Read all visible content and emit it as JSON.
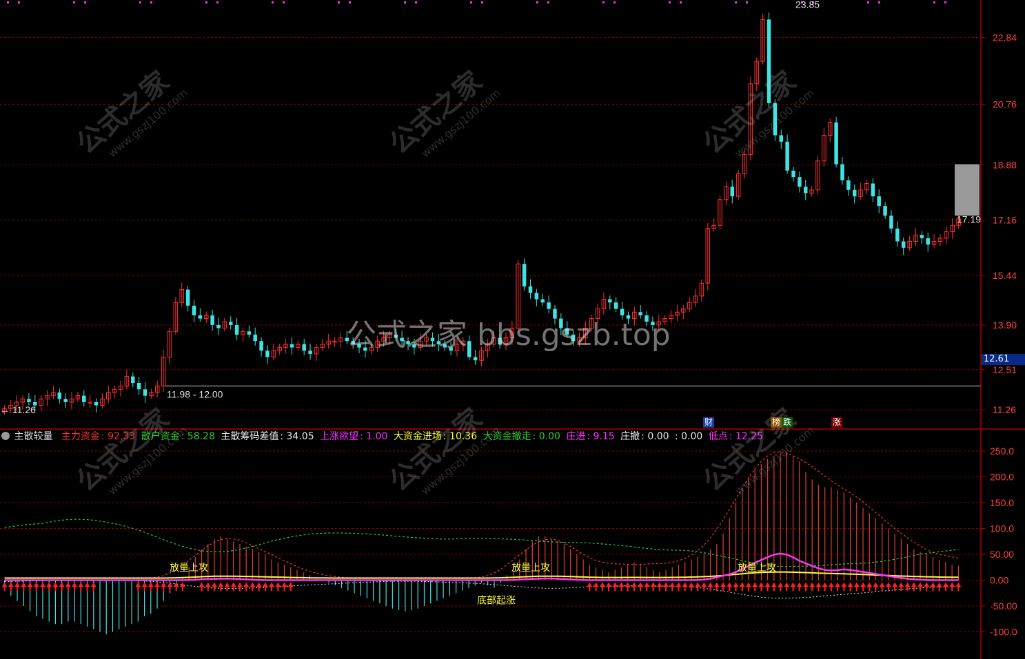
{
  "chart_data": [
    {
      "type": "candlestick",
      "title": "",
      "y_axis_labels": [
        "22.84",
        "20.76",
        "18.88",
        "17.16",
        "15.44",
        "13.90",
        "12.51",
        "11.26"
      ],
      "ylim": [
        10.9,
        23.9
      ],
      "annotations": {
        "high": "23.85",
        "low": "11.26",
        "range": "11.98 - 12.00",
        "last": "17.19"
      },
      "current_price": "12.61",
      "reference_line": 12.0,
      "closes": [
        11.3,
        11.4,
        11.5,
        11.6,
        11.5,
        11.4,
        11.6,
        11.7,
        11.8,
        11.6,
        11.5,
        11.6,
        11.7,
        11.5,
        11.5,
        11.4,
        11.6,
        11.8,
        11.9,
        12.0,
        12.3,
        12.1,
        11.9,
        11.7,
        11.8,
        12.0,
        12.9,
        13.7,
        14.6,
        15.0,
        14.5,
        14.2,
        14.1,
        14.2,
        13.9,
        13.8,
        14.0,
        13.9,
        13.6,
        13.7,
        13.6,
        13.4,
        13.1,
        12.9,
        13.1,
        13.2,
        13.3,
        13.2,
        13.3,
        13.1,
        13.0,
        13.2,
        13.3,
        13.4,
        13.4,
        13.5,
        13.4,
        13.3,
        13.2,
        13.1,
        13.2,
        13.4,
        13.5,
        13.6,
        13.5,
        13.4,
        13.3,
        13.2,
        13.4,
        13.5,
        13.4,
        13.3,
        13.2,
        13.1,
        13.3,
        13.4,
        12.9,
        12.8,
        13.1,
        13.3,
        13.5,
        13.3,
        13.5,
        13.8,
        15.8,
        15.1,
        14.9,
        14.7,
        14.6,
        14.4,
        14.1,
        13.8,
        13.6,
        13.4,
        13.5,
        13.8,
        14.1,
        14.4,
        14.7,
        14.6,
        14.4,
        14.2,
        14.1,
        14.3,
        14.2,
        14.0,
        13.9,
        14.0,
        14.1,
        14.2,
        14.3,
        14.4,
        14.6,
        14.8,
        15.2,
        16.9,
        17.0,
        17.8,
        18.2,
        17.9,
        18.6,
        19.2,
        21.4,
        22.1,
        23.4,
        20.8,
        19.8,
        19.6,
        18.7,
        18.5,
        18.2,
        18.0,
        18.1,
        19.0,
        19.8,
        20.2,
        18.9,
        18.4,
        18.1,
        17.9,
        18.1,
        18.3,
        17.9,
        17.6,
        17.3,
        16.9,
        16.5,
        16.3,
        16.5,
        16.7,
        16.6,
        16.4,
        16.5,
        16.6,
        16.8,
        17.0,
        17.2
      ]
    },
    {
      "type": "bar+line",
      "title": "主散较量",
      "y_axis_labels": [
        "250.0",
        "200.0",
        "150.0",
        "100.0",
        "50.00",
        "0.00",
        "-50.00",
        "-100.0"
      ],
      "ylim": [
        -150,
        270
      ],
      "series": [
        {
          "name": "主力资金",
          "value": "92.33",
          "color": "#ff3030"
        },
        {
          "name": "散户资金",
          "value": "58.28",
          "color": "#2ecc2e"
        },
        {
          "name": "主散筹码差值",
          "value": "34.05",
          "color": "#e8e8e8"
        },
        {
          "name": "上涨欲望",
          "value": "1.00",
          "color": "#ff33ff"
        },
        {
          "name": "大资金进场",
          "value": "10.36",
          "color": "#ffff33"
        },
        {
          "name": "大资金撤走",
          "value": "0.00",
          "color": "#2ecc2e"
        },
        {
          "name": "庄进",
          "value": "9.15",
          "color": "#ff33ff"
        },
        {
          "name": "庄撤",
          "value": "0.00",
          "color": "#e8e8e8"
        },
        {
          "name": "",
          "value": ": 0.00",
          "color": "#e8e8e8"
        },
        {
          "name": "低点",
          "value": "12.25",
          "color": "#ff33ff"
        }
      ],
      "signal_texts": [
        "放量上攻",
        "放量上攻",
        "底部起涨",
        "放量上攻"
      ],
      "bars": [
        -20,
        -30,
        -40,
        -50,
        -60,
        -70,
        -75,
        -80,
        -85,
        -85,
        -80,
        -80,
        -85,
        -90,
        -95,
        -100,
        -105,
        -100,
        -95,
        -90,
        -85,
        -80,
        -70,
        -65,
        -55,
        -40,
        -25,
        -10,
        5,
        25,
        45,
        60,
        70,
        80,
        85,
        80,
        75,
        70,
        65,
        60,
        55,
        50,
        40,
        35,
        30,
        25,
        20,
        15,
        10,
        5,
        0,
        -5,
        -10,
        -15,
        -20,
        -25,
        -30,
        -35,
        -40,
        -45,
        -50,
        -55,
        -58,
        -60,
        -58,
        -55,
        -50,
        -45,
        -40,
        -35,
        -30,
        -25,
        -20,
        -15,
        -10,
        -5,
        -10,
        -15,
        -5,
        10,
        25,
        40,
        60,
        75,
        85,
        85,
        80,
        75,
        70,
        60,
        50,
        40,
        30,
        25,
        20,
        15,
        20,
        25,
        30,
        35,
        30,
        25,
        20,
        15,
        20,
        25,
        30,
        35,
        40,
        45,
        50,
        60,
        70,
        90,
        120,
        150,
        175,
        200,
        215,
        225,
        235,
        240,
        245,
        245,
        240,
        230,
        210,
        195,
        185,
        180,
        180,
        175,
        170,
        160,
        150,
        140,
        130,
        120,
        110,
        100,
        90,
        80,
        70,
        60,
        55,
        50,
        45,
        40,
        35,
        30,
        28
      ],
      "signals": {
        "up_arrows": [
          0,
          1,
          2,
          3,
          4,
          5,
          6,
          7,
          8,
          9,
          10,
          11,
          12,
          13,
          14,
          21,
          22,
          23,
          24,
          25,
          26,
          27,
          28,
          31,
          32,
          33,
          34,
          35,
          36,
          37,
          38,
          39,
          40,
          41,
          42,
          43,
          44,
          45,
          92,
          93,
          94,
          95,
          96,
          97,
          98,
          99,
          100,
          101,
          102,
          103,
          104,
          105,
          106,
          107,
          108,
          109,
          110,
          111,
          112,
          113,
          114,
          115,
          116,
          117,
          118,
          119,
          120,
          121,
          122,
          123,
          124,
          125,
          126,
          127,
          128,
          129,
          130,
          131,
          132,
          133,
          134,
          135,
          136,
          137,
          138,
          139,
          140,
          141,
          142,
          143,
          144,
          145,
          146,
          147,
          148,
          149,
          150,
          151,
          152,
          153,
          154,
          155,
          156,
          157,
          158,
          159,
          160,
          161,
          162,
          163,
          164,
          165,
          166,
          167,
          168,
          169,
          170,
          171,
          172,
          173,
          174,
          175,
          176,
          177,
          178,
          179,
          180,
          181,
          182,
          183,
          184,
          185,
          186,
          187,
          188,
          189,
          190,
          191,
          192,
          193,
          194,
          195,
          196,
          197
        ]
      },
      "badges": [
        "财",
        "榜",
        "跌",
        "涨"
      ]
    }
  ],
  "watermark": {
    "text": "公式之家",
    "url": "www.gszj100.com",
    "center": "公式之家 bbs.gszb.top"
  },
  "colors": {
    "up": "#ff3030",
    "down": "#3fe3e3",
    "grid": "#8a0000",
    "axis": "#b00000",
    "axis_label": "#ff4040",
    "dots": "#ff33ff"
  }
}
